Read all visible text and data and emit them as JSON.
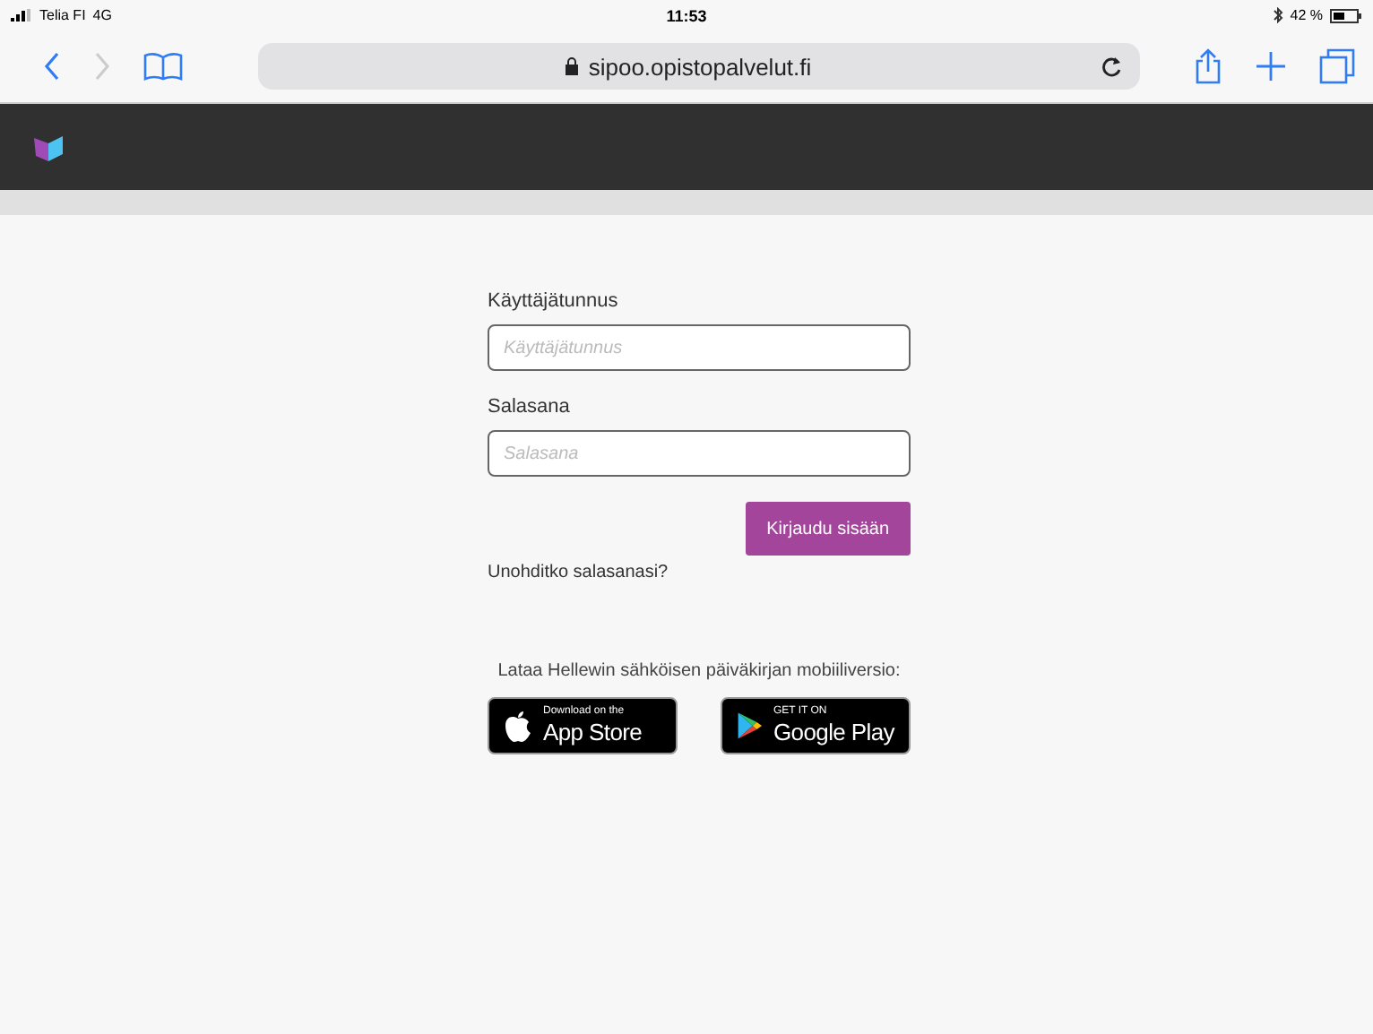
{
  "status_bar": {
    "carrier": "Telia FI",
    "network": "4G",
    "time": "11:53",
    "battery": "42 %"
  },
  "browser": {
    "url": "sipoo.opistopalvelut.fi"
  },
  "login": {
    "username_label": "Käyttäjätunnus",
    "username_placeholder": "Käyttäjätunnus",
    "password_label": "Salasana",
    "password_placeholder": "Salasana",
    "submit": "Kirjaudu sisään",
    "forgot": "Unohditko salasanasi?"
  },
  "apps": {
    "text": "Lataa Hellewin sähköisen päiväkirjan mobiiliversio:",
    "badges": [
      {
        "kind": "apple",
        "small": "Download on the",
        "big": "App Store"
      },
      {
        "kind": "google",
        "small": "GET IT ON",
        "big": "Google Play"
      }
    ]
  }
}
